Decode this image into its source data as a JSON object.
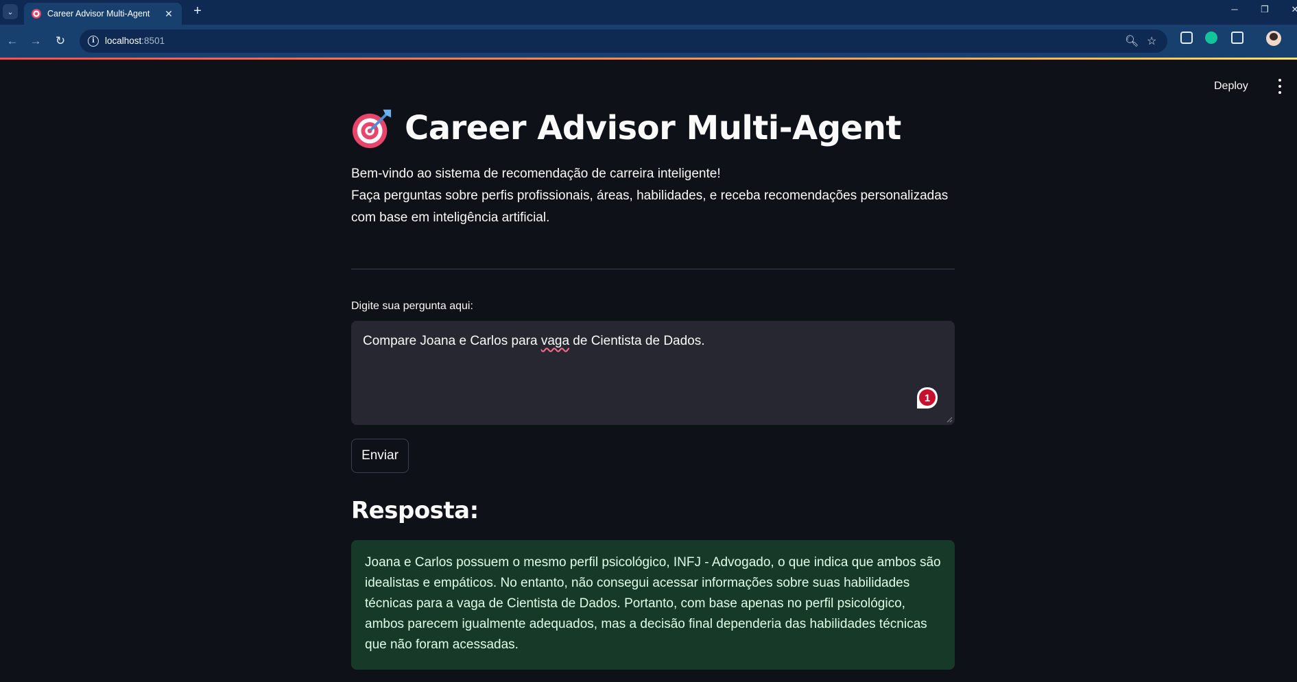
{
  "browser": {
    "tab_title": "Career Advisor Multi-Agent",
    "url_host": "localhost",
    "url_port": ":8501"
  },
  "header": {
    "deploy_label": "Deploy"
  },
  "page": {
    "title": "Career Advisor Multi-Agent",
    "title_icon": "direct-hit-target-emoji",
    "intro_line1": "Bem-vindo ao sistema de recomendação de carreira inteligente!",
    "intro_line2": "Faça perguntas sobre perfis profissionais, áreas, habilidades, e receba recomendações personalizadas com base em inteligência artificial."
  },
  "question": {
    "label": "Digite sua pergunta aqui:",
    "value_before": "Compare Joana e Carlos para ",
    "value_misspelled": "vaga",
    "value_after": " de Cientista de Dados.",
    "grammarly_count": "1"
  },
  "actions": {
    "send_label": "Enviar"
  },
  "answer": {
    "heading": "Resposta:",
    "text": "Joana e Carlos possuem o mesmo perfil psicológico, INFJ - Advogado, o que indica que ambos são idealistas e empáticos. No entanto, não consegui acessar informações sobre suas habilidades técnicas para a vaga de Cientista de Dados. Portanto, com base apenas no perfil psicológico, ambos parecem igualmente adequados, mas a decisão final dependeria das habilidades técnicas que não foram acessadas."
  },
  "colors": {
    "background": "#0e1117",
    "input_bg": "#262730",
    "success_bg": "#173928",
    "success_text": "#dffde9",
    "accent_gradient": [
      "#ff4b4b",
      "#ffbd45",
      "#ffe45c"
    ]
  }
}
